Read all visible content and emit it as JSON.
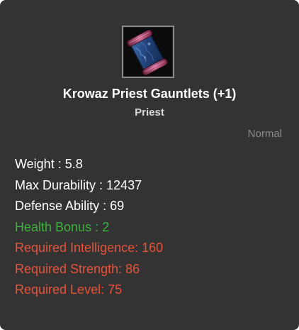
{
  "item": {
    "icon": "gauntlets-icon",
    "name": "Krowaz Priest Gauntlets (+1)",
    "class": "Priest",
    "grade": "Normal"
  },
  "stats": [
    {
      "text": "Weight : 5.8",
      "color": "#ffffff"
    },
    {
      "text": "Max Durability : 12437",
      "color": "#ffffff"
    },
    {
      "text": "Defense Ability : 69",
      "color": "#ffffff"
    },
    {
      "text": "Health Bonus : 2",
      "color": "#3eb03e"
    },
    {
      "text": "Required Intelligence: 160",
      "color": "#e8533a"
    },
    {
      "text": "Required Strength: 86",
      "color": "#e8533a"
    },
    {
      "text": "Required Level: 75",
      "color": "#e8533a"
    }
  ],
  "colors": {
    "background": "#333333",
    "name": "#ffffff",
    "class": "#d7d7d7",
    "grade": "#8e8e8e",
    "bonus": "#3eb03e",
    "requirement": "#e8533a"
  }
}
